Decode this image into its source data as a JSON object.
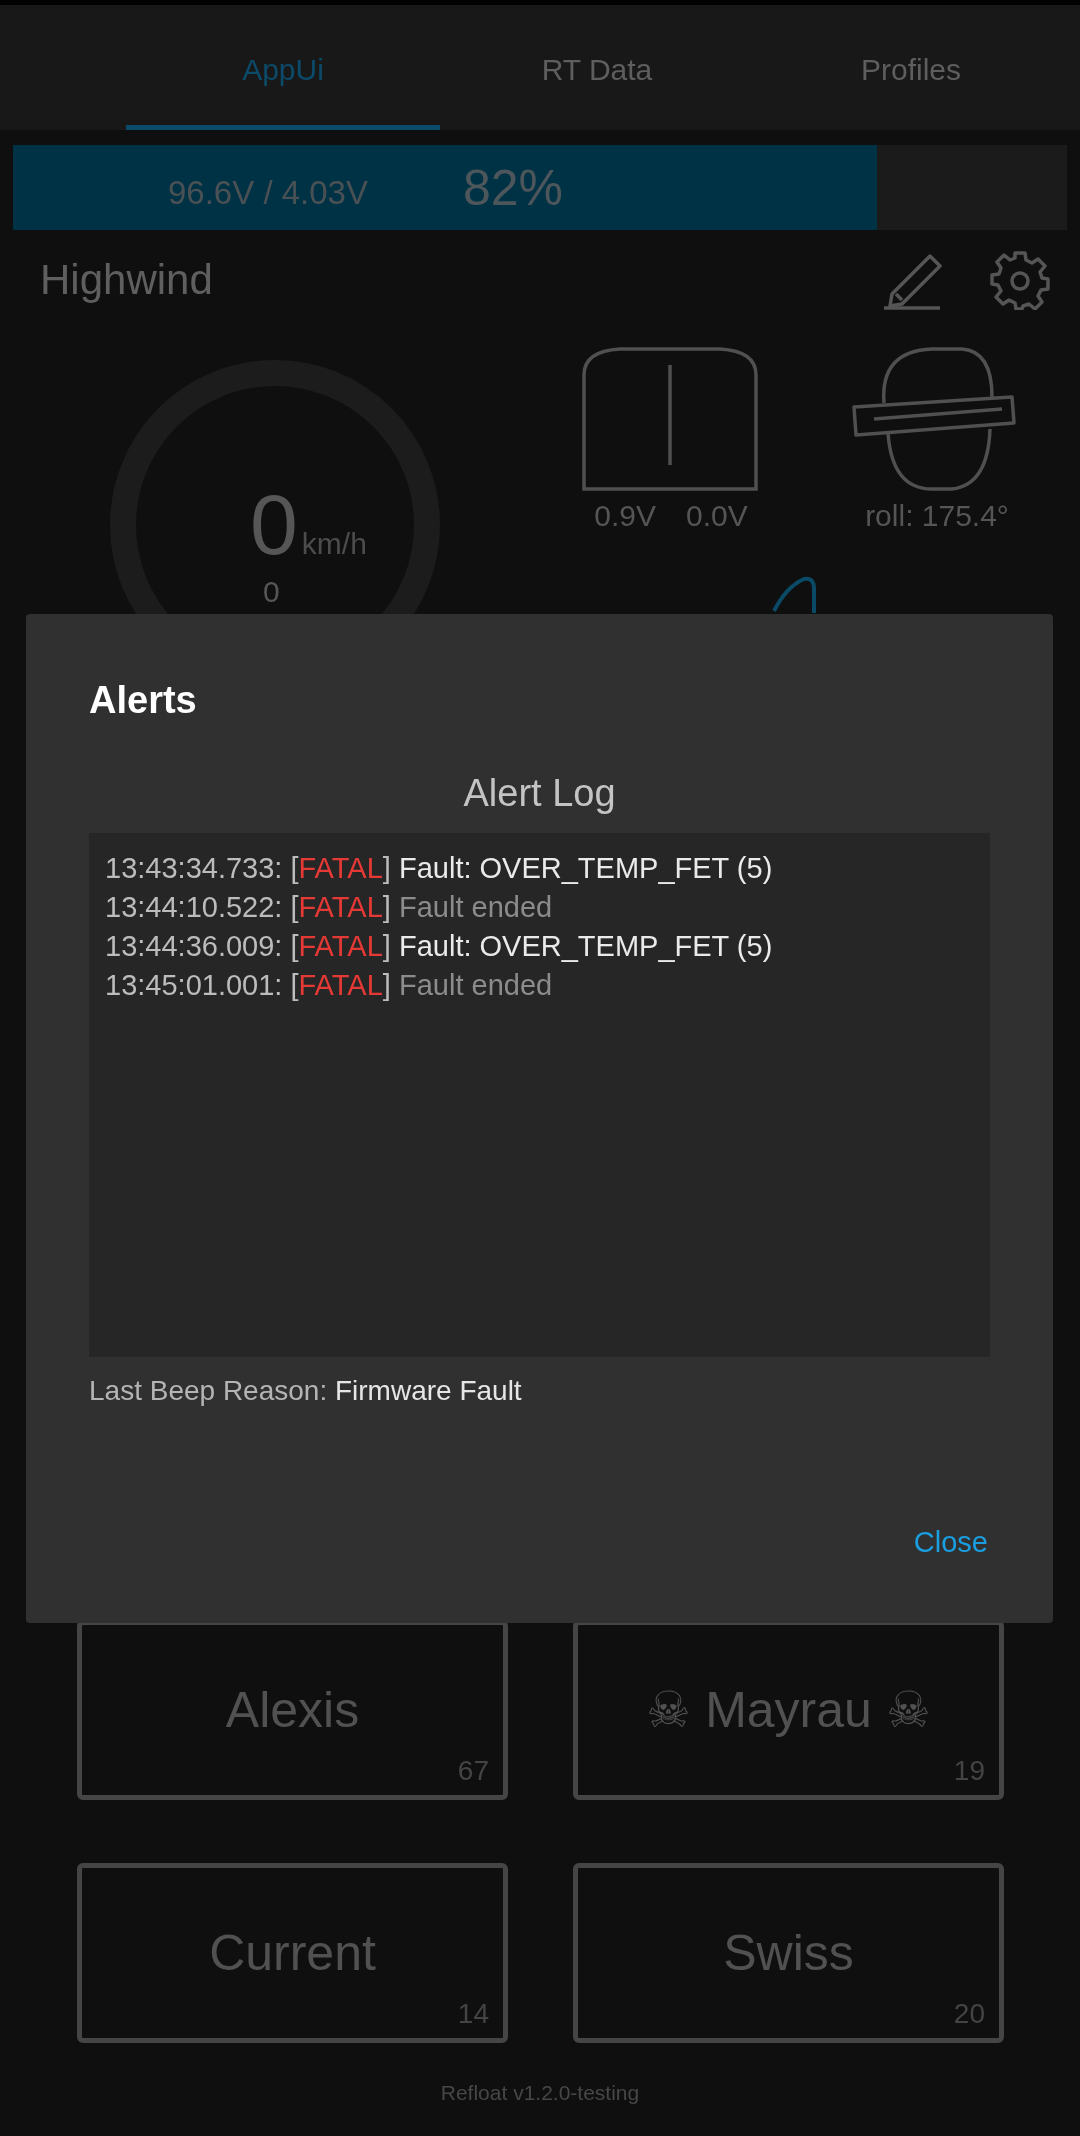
{
  "tabs": [
    {
      "label": "AppUi",
      "selected": true
    },
    {
      "label": "RT Data",
      "selected": false
    },
    {
      "label": "Profiles",
      "selected": false
    }
  ],
  "battery": {
    "voltage": "96.6V / 4.03V",
    "percent": "82%",
    "level": 0.82
  },
  "board_name": "Highwind",
  "speed": {
    "value": "0",
    "unit": "km/h",
    "secondary": "0"
  },
  "footpad": {
    "left": "0.9V",
    "right": "0.0V"
  },
  "roll": "roll: 175.4°",
  "dialog": {
    "title": "Alerts",
    "subtitle": "Alert Log",
    "log": [
      {
        "time": "13:43:34.733:",
        "open": "[",
        "level": "FATAL",
        "close": "]",
        "message": "Fault: OVER_TEMP_FET (5)",
        "kind": "fault"
      },
      {
        "time": "13:44:10.522:",
        "open": "[",
        "level": "FATAL",
        "close": "]",
        "message": "Fault ended",
        "kind": "ended"
      },
      {
        "time": "13:44:36.009:",
        "open": "[",
        "level": "FATAL",
        "close": "]",
        "message": "Fault: OVER_TEMP_FET (5)",
        "kind": "fault"
      },
      {
        "time": "13:45:01.001:",
        "open": "[",
        "level": "FATAL",
        "close": "]",
        "message": "Fault ended",
        "kind": "ended"
      }
    ],
    "beep_label": "Last Beep Reason:",
    "beep_value": "Firmware Fault",
    "button": "Close"
  },
  "profiles": [
    {
      "name": "Alexis",
      "count": "67"
    },
    {
      "name": "☠ Mayrau ☠",
      "count": "19"
    },
    {
      "name": "Current",
      "count": "14"
    },
    {
      "name": "Swiss",
      "count": "20"
    }
  ],
  "footer": "Refloat v1.2.0-testing"
}
